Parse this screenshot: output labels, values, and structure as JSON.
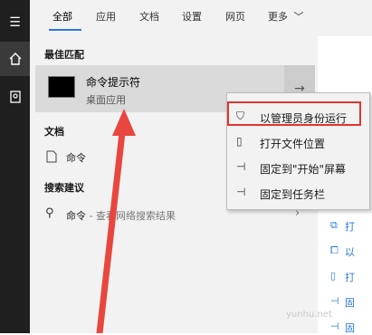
{
  "tabs": [
    "全部",
    "应用",
    "文档",
    "设置",
    "网页",
    "更多"
  ],
  "sections": {
    "best_match": "最佳匹配",
    "documents": "文档",
    "search_suggestions": "搜索建议"
  },
  "best_match_item": {
    "title": "命令提示符",
    "subtitle": "桌面应用"
  },
  "document_item": {
    "label": "命令"
  },
  "suggestion_item": {
    "query": "命令",
    "hint": " - 查看网络搜索结果"
  },
  "context_menu": [
    {
      "icon": "shield-admin-icon",
      "label": "以管理员身份运行"
    },
    {
      "icon": "folder-location-icon",
      "label": "打开文件位置"
    },
    {
      "icon": "pin-icon",
      "label": "固定到\"开始\"屏幕"
    },
    {
      "icon": "pin-icon",
      "label": "固定到任务栏"
    }
  ],
  "right_panel_letters": [
    "打",
    "以",
    "打",
    "固",
    "固"
  ],
  "watermark": "yunhu.net",
  "colors": {
    "accent": "#2b79d8",
    "highlight_border": "#e0362f",
    "arrow": "#e8463e"
  }
}
